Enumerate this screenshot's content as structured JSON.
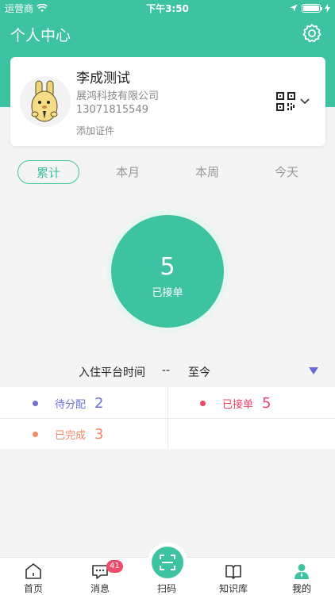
{
  "status_bar": {
    "carrier": "运营商",
    "time": "下午3:50"
  },
  "header": {
    "title": "个人中心"
  },
  "profile": {
    "name": "李成测试",
    "company": "展鸿科技有限公司",
    "phone": "13071815549",
    "add_cert": "添加证件"
  },
  "tabs": [
    {
      "label": "累计",
      "active": true
    },
    {
      "label": "本月",
      "active": false
    },
    {
      "label": "本周",
      "active": false
    },
    {
      "label": "今天",
      "active": false
    }
  ],
  "summary": {
    "value": "5",
    "label": "已接单"
  },
  "period": {
    "label": "入住平台时间",
    "dash": "--",
    "until": "至今"
  },
  "stats": [
    {
      "label": "待分配",
      "value": "2",
      "color": "#6c6fd6"
    },
    {
      "label": "已接单",
      "value": "5",
      "color": "#e9466a"
    },
    {
      "label": "已完成",
      "value": "3",
      "color": "#ee8a6b"
    }
  ],
  "tabbar": {
    "items": [
      {
        "label": "首页",
        "icon": "home-icon"
      },
      {
        "label": "消息",
        "icon": "message-icon",
        "badge": "41"
      },
      {
        "label": "扫码",
        "icon": "scan-icon"
      },
      {
        "label": "知识库",
        "icon": "book-icon"
      },
      {
        "label": "我的",
        "icon": "user-icon"
      }
    ]
  },
  "colors": {
    "accent": "#3ec3a2",
    "dropdown": "#6a69d8"
  }
}
